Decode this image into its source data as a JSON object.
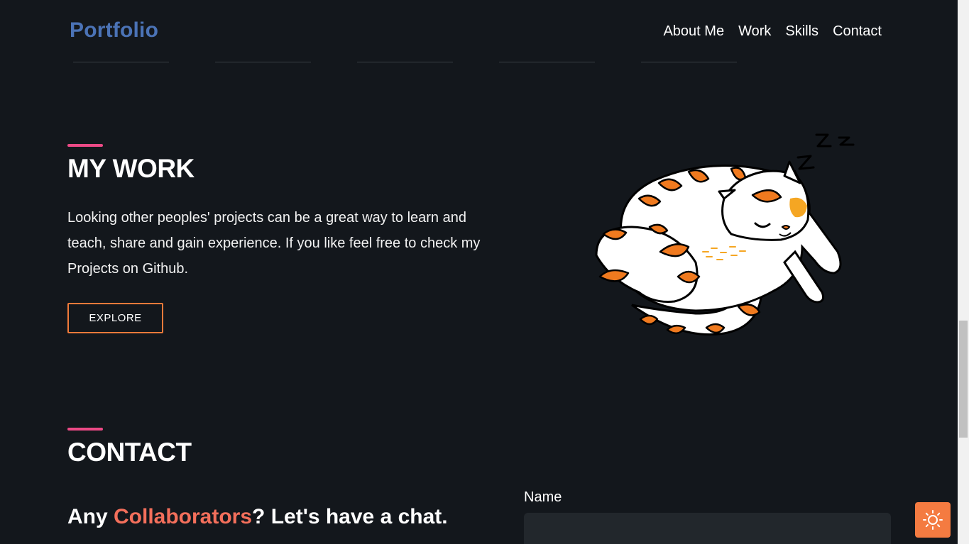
{
  "header": {
    "brand": "Portfolio",
    "nav": [
      "About Me",
      "Work",
      "Skills",
      "Contact"
    ]
  },
  "work": {
    "title": "MY WORK",
    "description": "Looking other peoples' projects can be a great way to learn and teach, share and gain experience. If you like feel free to check my Projects on Github.",
    "button": "EXPLORE"
  },
  "contact": {
    "title": "CONTACT",
    "chat_prefix": "Any ",
    "chat_highlight": "Collaborators",
    "chat_suffix": "? Let's have a chat.",
    "name_label": "Name",
    "name_value": ""
  },
  "illustration": {
    "sleep_glyphs": [
      "Z",
      "Z",
      "Z"
    ]
  },
  "colors": {
    "background": "#13171c",
    "brand": "#4b73b6",
    "accent_pink": "#ec4a86",
    "accent_orange": "#f47b41",
    "highlight": "#f36f5b"
  },
  "icons": {
    "theme_toggle": "sun-icon"
  }
}
